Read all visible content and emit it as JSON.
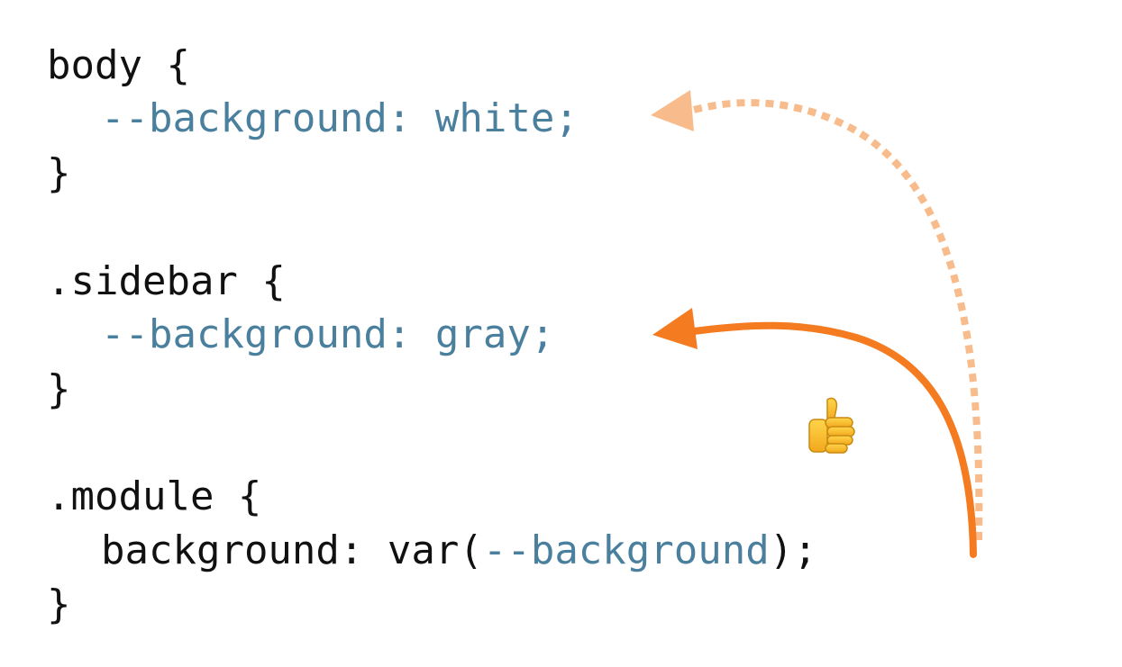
{
  "code": {
    "block_body": {
      "selector_line": "body {",
      "prop": "--background: white;",
      "close": "}"
    },
    "block_sidebar": {
      "selector_line": ".sidebar {",
      "prop": "--background: gray;",
      "close": "}"
    },
    "block_module": {
      "selector_line": ".module {",
      "prop_prefix": "background: var(",
      "prop_var": "--background",
      "prop_suffix": ");",
      "close": "}"
    }
  },
  "colors": {
    "code_text": "#111111",
    "variable_text": "#4a7f9e",
    "arrow_solid": "#f47b20",
    "arrow_dotted": "#f8bc8c"
  },
  "icons": {
    "thumbs_up": "thumbs-up-icon"
  }
}
